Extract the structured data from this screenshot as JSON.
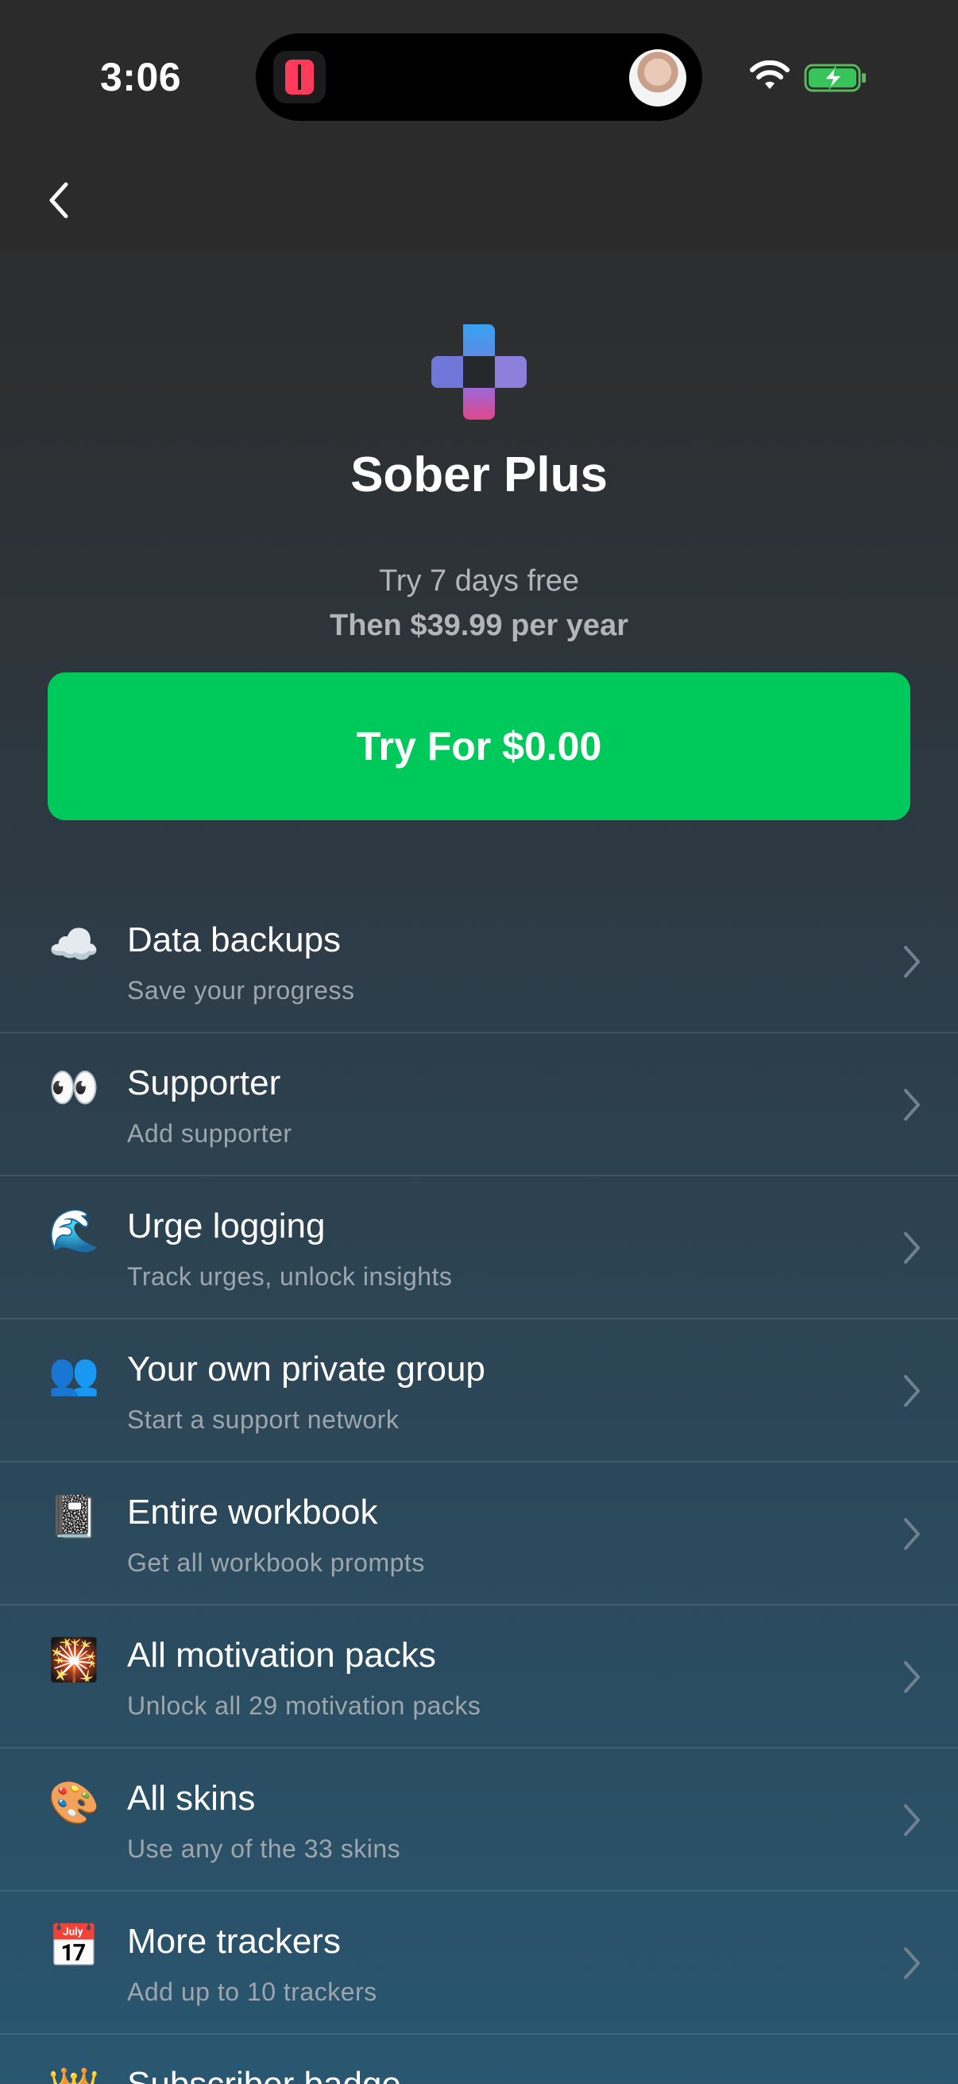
{
  "status_bar": {
    "time": "3:06"
  },
  "nav": {
    "back_icon": "chevron-left-icon"
  },
  "header": {
    "title": "Sober Plus",
    "trial_text": "Try 7 days free",
    "price_text": "Then $39.99 per year",
    "cta_label": "Try For $0.00"
  },
  "colors": {
    "cta_green": "#00c95b",
    "background_top": "#2b2b2b",
    "background_bottom": "#295670",
    "subtitle_gray": "#9ea6ad"
  },
  "features": [
    {
      "icon": "cloud-icon",
      "emoji": "☁️",
      "label": "Data backups",
      "sub": "Save your progress"
    },
    {
      "icon": "eyes-icon",
      "emoji": "👀",
      "label": "Supporter",
      "sub": "Add supporter"
    },
    {
      "icon": "wave-icon",
      "emoji": "🌊",
      "label": "Urge logging",
      "sub": "Track urges, unlock insights"
    },
    {
      "icon": "people-icon",
      "emoji": "👥",
      "label": "Your own private group",
      "sub": "Start a support network"
    },
    {
      "icon": "notebook-icon",
      "emoji": "📓",
      "label": "Entire workbook",
      "sub": "Get all workbook prompts"
    },
    {
      "icon": "sparkler-icon",
      "emoji": "🎇",
      "label": "All motivation packs",
      "sub": "Unlock all 29 motivation packs"
    },
    {
      "icon": "palette-icon",
      "emoji": "🎨",
      "label": "All skins",
      "sub": "Use any of the 33 skins"
    },
    {
      "icon": "calendar-icon",
      "emoji": "📅",
      "label": "More trackers",
      "sub": "Add up to 10 trackers"
    },
    {
      "icon": "crown-icon",
      "emoji": "👑",
      "label": "Subscriber badge",
      "sub": ""
    }
  ]
}
